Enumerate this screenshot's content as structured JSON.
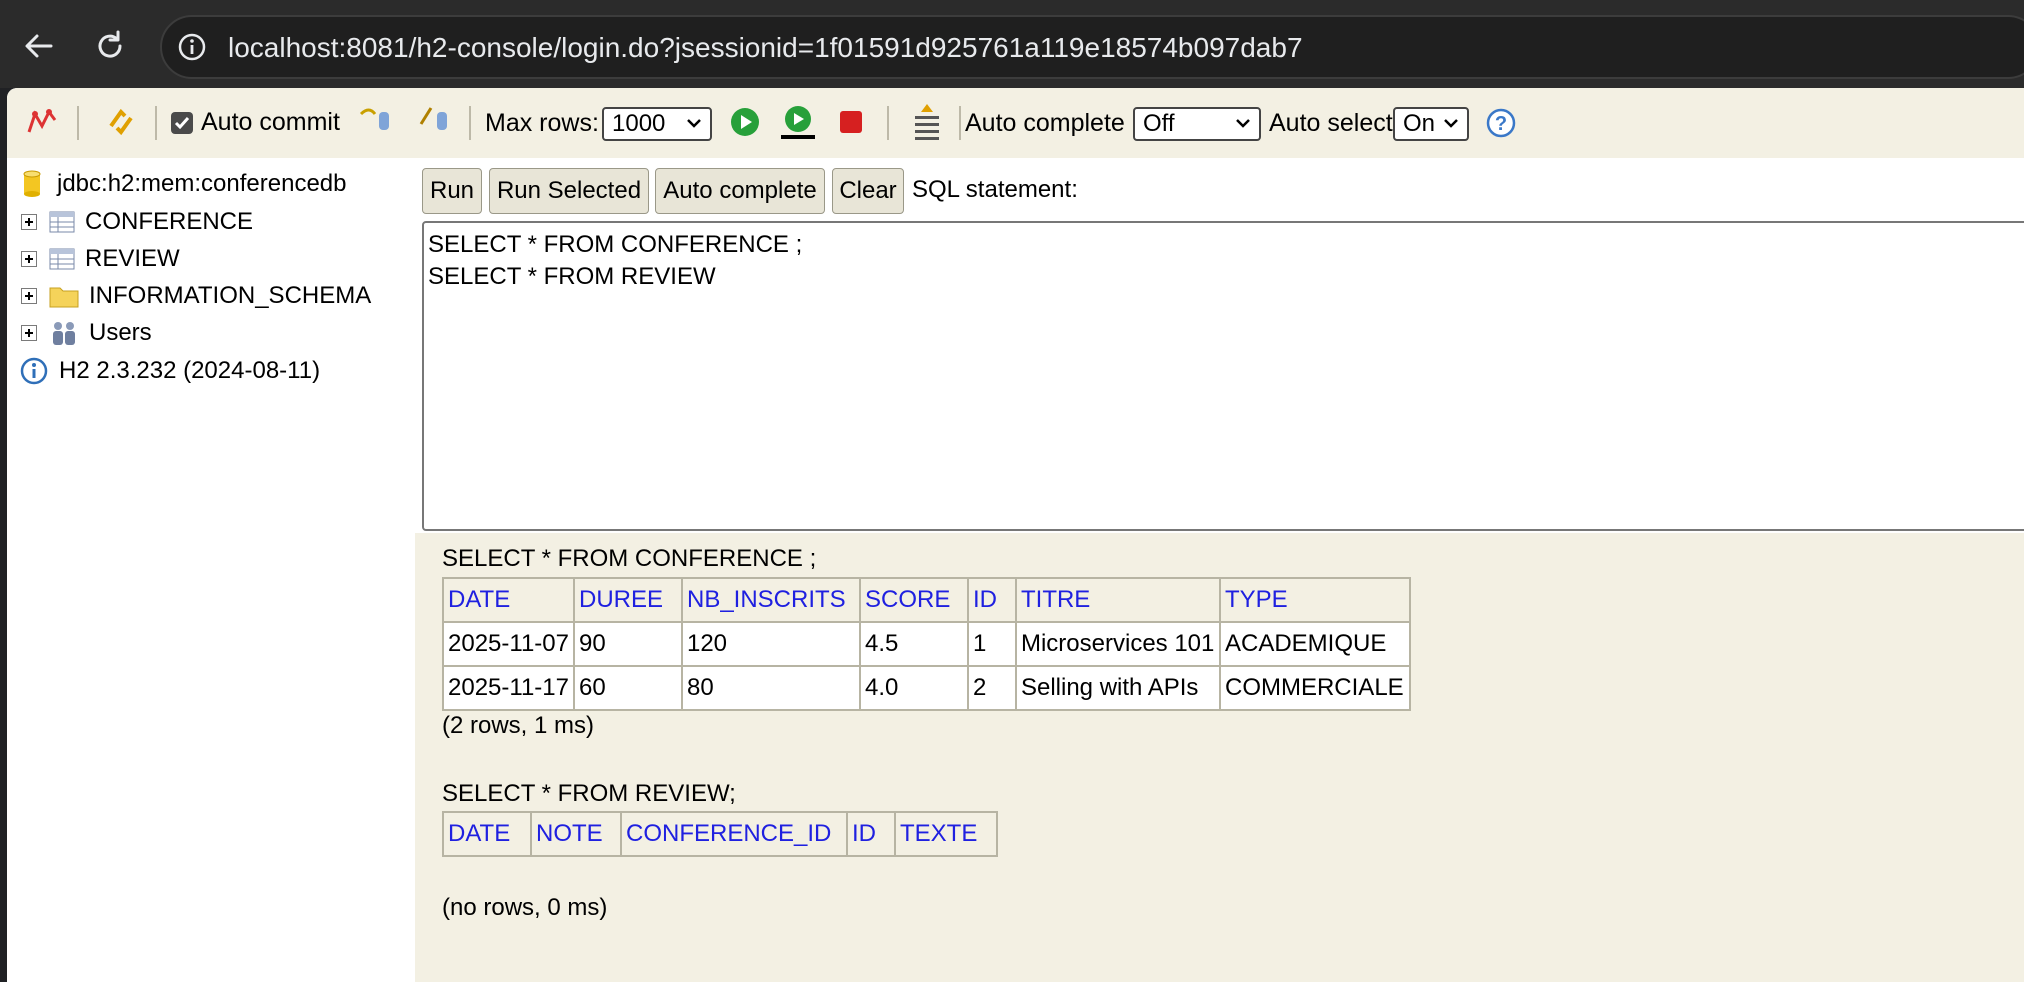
{
  "browser": {
    "url": "localhost:8081/h2-console/login.do?jsessionid=1f01591d925761a119e18574b097dab7"
  },
  "toolbar": {
    "auto_commit_label": "Auto commit",
    "auto_commit_checked": true,
    "max_rows_label": "Max rows:",
    "max_rows_value": "1000",
    "auto_complete_label": "Auto complete",
    "auto_complete_value": "Off",
    "auto_select_label": "Auto select",
    "auto_select_value": "On",
    "help_icon": "?"
  },
  "tree": {
    "connection": "jdbc:h2:mem:conferencedb",
    "items": [
      {
        "label": "CONFERENCE",
        "icon": "table-icon"
      },
      {
        "label": "REVIEW",
        "icon": "table-icon"
      },
      {
        "label": "INFORMATION_SCHEMA",
        "icon": "folder-icon"
      },
      {
        "label": "Users",
        "icon": "users-icon"
      }
    ],
    "version": "H2 2.3.232 (2024-08-11)"
  },
  "query": {
    "buttons": {
      "run": "Run",
      "run_selected": "Run Selected",
      "auto_complete": "Auto complete",
      "clear": "Clear"
    },
    "sql_label": "SQL statement:",
    "sql_text": "SELECT * FROM CONFERENCE ;\nSELECT * FROM REVIEW"
  },
  "results": [
    {
      "statement": "SELECT * FROM CONFERENCE ;",
      "columns": [
        "DATE",
        "DUREE",
        "NB_INSCRITS",
        "SCORE",
        "ID",
        "TITRE",
        "TYPE"
      ],
      "rows": [
        [
          "2025-11-07",
          "90",
          "120",
          "4.5",
          "1",
          "Microservices 101",
          "ACADEMIQUE"
        ],
        [
          "2025-11-17",
          "60",
          "80",
          "4.0",
          "2",
          "Selling with APIs",
          "COMMERCIALE"
        ]
      ],
      "footer": "(2 rows, 1 ms)"
    },
    {
      "statement": "SELECT * FROM REVIEW;",
      "columns": [
        "DATE",
        "NOTE",
        "CONFERENCE_ID",
        "ID",
        "TEXTE"
      ],
      "rows": [],
      "footer": "(no rows, 0 ms)"
    }
  ],
  "colors": {
    "panel_bg": "#f3f0e3",
    "header_text": "#1f20e0",
    "browser_chrome": "#2b2b2b"
  }
}
